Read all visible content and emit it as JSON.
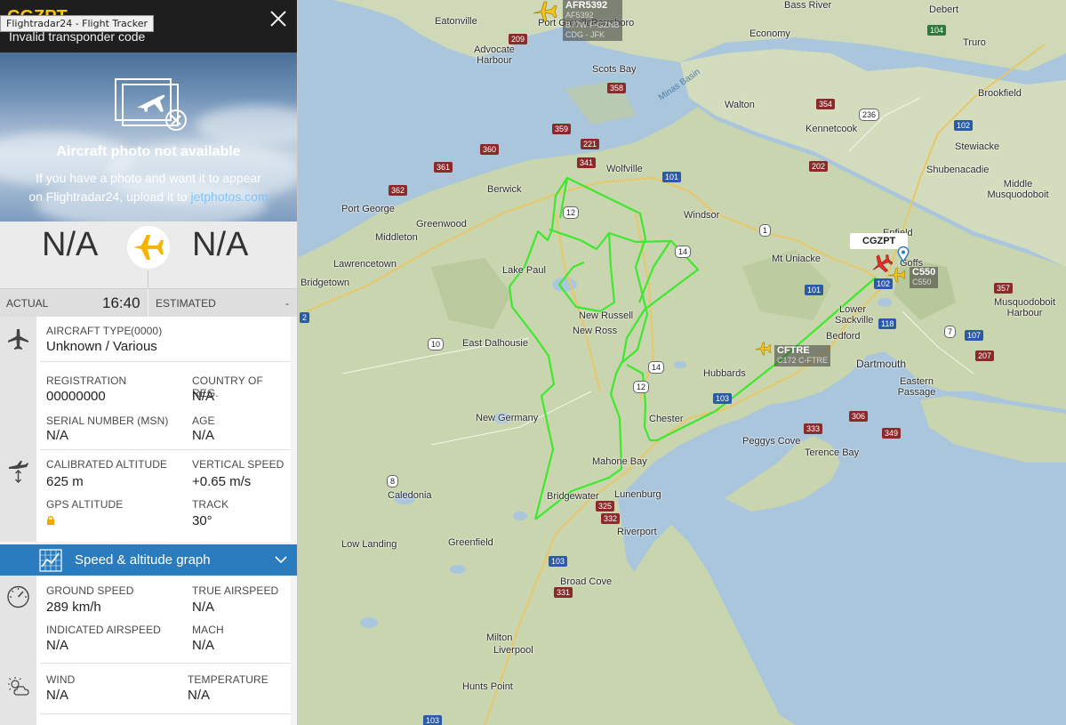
{
  "header": {
    "callsign": "CGZPT",
    "tooltip": "Flightradar24 - Flight Tracker",
    "subtitle": "Invalid transponder code"
  },
  "photo": {
    "title": "Aircraft photo not available",
    "text_line1": "If you have a photo and want it to appear",
    "text_line2_prefix": "on Flightradar24, upload it to ",
    "link": "jetphotos.com"
  },
  "route": {
    "from": "N/A",
    "to": "N/A"
  },
  "times": {
    "actual_label": "ACTUAL",
    "actual_value": "16:40",
    "estimated_label": "ESTIMATED",
    "estimated_value": "-"
  },
  "aircraft": {
    "type_label": "AIRCRAFT TYPE",
    "type_code": "(0000)",
    "type_value": "Unknown / Various",
    "registration_label": "REGISTRATION",
    "registration_value": "00000000",
    "country_label": "COUNTRY OF REG.",
    "country_value": "N/A",
    "serial_label": "SERIAL NUMBER (MSN)",
    "serial_value": "N/A",
    "age_label": "AGE",
    "age_value": "N/A"
  },
  "altitude": {
    "cal_alt_label": "CALIBRATED ALTITUDE",
    "cal_alt_value": "625 m",
    "vspeed_label": "VERTICAL SPEED",
    "vspeed_value": "+0.65 m/s",
    "gps_alt_label": "GPS ALTITUDE",
    "track_label": "TRACK",
    "track_value": "30°"
  },
  "graph": {
    "label": "Speed & altitude graph"
  },
  "speed": {
    "ground_label": "GROUND SPEED",
    "ground_value": "289 km/h",
    "true_label": "TRUE AIRSPEED",
    "true_value": "N/A",
    "indicated_label": "INDICATED AIRSPEED",
    "indicated_value": "N/A",
    "mach_label": "MACH",
    "mach_value": "N/A"
  },
  "weather": {
    "wind_label": "WIND",
    "wind_value": "N/A",
    "temp_label": "TEMPERATURE",
    "temp_value": "N/A"
  },
  "map": {
    "selected_label": "CGZPT",
    "aircraft": [
      {
        "callsign": "AFR5392",
        "line2": "AF5392",
        "line3": "B77W F-GZNB",
        "line4": "CDG - JFK"
      },
      {
        "callsign": "CFTRE",
        "line2": "C172 C-FTRE"
      },
      {
        "callsign": "C550",
        "line2": "C550"
      }
    ],
    "places": [
      "Eatonville",
      "Port Greville",
      "Parrsboro",
      "Advocate Harbour",
      "Economy",
      "Bass River",
      "Debert",
      "Truro",
      "Scots Bay",
      "Walton",
      "Brookfield",
      "Kennetcook",
      "Stewiacke",
      "Shubenacadie",
      "Middle Musquodoboit",
      "Wolfville",
      "Berwick",
      "Port George",
      "Windsor",
      "Greenwood",
      "Middleton",
      "Lawrencetown",
      "Bridgetown",
      "Lake Paul",
      "Mt Uniacke",
      "Enfield",
      "Goffs",
      "Lower Sackville",
      "Bedford",
      "Dartmouth",
      "Eastern Passage",
      "New Russell",
      "New Ross",
      "East Dalhousie",
      "Hubbards",
      "Chester",
      "Peggys Cove",
      "Terence Bay",
      "New Germany",
      "Mahone Bay",
      "Lunenburg",
      "Bridgewater",
      "Caledonia",
      "Low Landing",
      "Greenfield",
      "Riverport",
      "Broad Cove",
      "Milton",
      "Liverpool",
      "Hunts Point",
      "Musquodoboit Harbour",
      "Minas Basin"
    ],
    "roads": [
      "209",
      "358",
      "359",
      "221",
      "360",
      "341",
      "361",
      "362",
      "101",
      "12",
      "14",
      "354",
      "236",
      "102",
      "202",
      "1",
      "101",
      "102",
      "118",
      "7",
      "107",
      "357",
      "207",
      "10",
      "12",
      "14",
      "103",
      "333",
      "306",
      "349",
      "8",
      "332",
      "325",
      "103",
      "331",
      "103",
      "104",
      "2"
    ]
  }
}
